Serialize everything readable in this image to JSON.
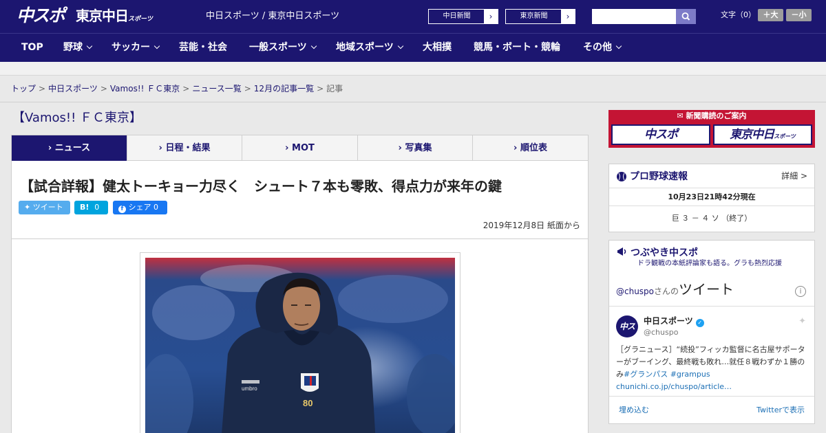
{
  "header": {
    "logo_chuspo": "中スポ",
    "logo_tokyo": "東京中日",
    "logo_tokyo_small": "スポーツ",
    "site_name": "中日スポーツ / 東京中日スポーツ",
    "paper_links": [
      {
        "label": "中日新聞",
        "arrow": "›"
      },
      {
        "label": "東京新聞",
        "arrow": "›"
      }
    ],
    "search_placeholder": "",
    "font_size_label": "文字（0）",
    "font_bigger": "＋大",
    "font_smaller": "－小"
  },
  "nav": {
    "items": [
      {
        "label": "TOP",
        "has_dropdown": false
      },
      {
        "label": "野球",
        "has_dropdown": true
      },
      {
        "label": "サッカー",
        "has_dropdown": true
      },
      {
        "label": "芸能・社会",
        "has_dropdown": false
      },
      {
        "label": "一般スポーツ",
        "has_dropdown": true
      },
      {
        "label": "地域スポーツ",
        "has_dropdown": true
      },
      {
        "label": "大相撲",
        "has_dropdown": false
      },
      {
        "label": "競馬・ボート・競輪",
        "has_dropdown": false
      },
      {
        "label": "その他",
        "has_dropdown": true
      }
    ]
  },
  "breadcrumb": {
    "items": [
      "トップ",
      "中日スポーツ",
      "Vamos!! ＦＣ東京",
      "ニュース一覧",
      "12月の記事一覧"
    ],
    "current": "記事",
    "separator": ">"
  },
  "section_title": "【Vamos!! ＦＣ東京】",
  "tabs": [
    {
      "label": "ニュース",
      "active": true
    },
    {
      "label": "日程・結果",
      "active": false
    },
    {
      "label": "MOT",
      "active": false
    },
    {
      "label": "写真集",
      "active": false
    },
    {
      "label": "順位表",
      "active": false
    }
  ],
  "tab_prefix": "›",
  "article": {
    "headline": "【試合詳報】健太トーキョー力尽く　シュート７本も零敗、得点力が来年の鍵",
    "share": {
      "tweet_label": "ツイート",
      "hatena_label": "B!",
      "hatena_count": "0",
      "facebook_label": "シェア",
      "facebook_count": "0"
    },
    "dateline": "2019年12月8日 紙面から",
    "photo_jersey_number": "80",
    "photo_brand": "umbro"
  },
  "sidebar": {
    "ad": {
      "title": "新聞購読のご案内",
      "button_chuspo": "中スポ",
      "button_tokyo": "東京中日",
      "button_tokyo_small": "スポーツ"
    },
    "pro_baseball": {
      "title": "プロ野球速報",
      "more": "詳細 >",
      "timestamp": "10月23日21時42分現在",
      "score": "巨 ３ － ４ ソ （終了）"
    },
    "tsubuyaki": {
      "title": "つぶやき中スポ",
      "subtitle": "ドラ観戦の本紙評論家も語る。グラも熱烈応援",
      "handle": "@chuspo",
      "handle_suffix": "さんの",
      "tweets_label": "ツイート",
      "info_icon": "i",
      "tweet": {
        "avatar_text": "中スポ",
        "name": "中日スポーツ",
        "user": "@chuspo",
        "text_plain": "［グラニュース］“続投”フィッカ監督に名古屋サポーターがブーイング、最終戦も敗れ…就任８戦わずか１勝のみ",
        "hashtags": "#グランパス #grampus",
        "link": "chunichi.co.jp/chuspo/article…"
      },
      "embed_label": "埋め込む",
      "view_label": "Twitterで表示"
    }
  },
  "colors": {
    "brand": "#1c1670",
    "ad_red": "#c41434",
    "twitter_blue": "#55acee",
    "hatena_blue": "#00a4de",
    "facebook_blue": "#1877f2"
  }
}
